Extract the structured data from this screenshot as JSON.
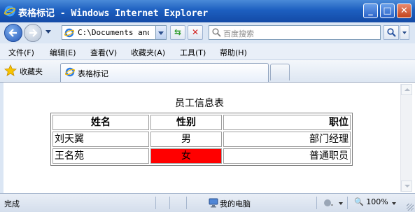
{
  "window": {
    "title": "表格标记 - Windows Internet Explorer",
    "min_icon": "minimize-icon",
    "max_icon": "maximize-icon",
    "close_icon": "close-icon",
    "frame_color": "#1d5fc0"
  },
  "address_bar": {
    "url": "C:\\Documents and S",
    "page_icon": "ie-page-icon"
  },
  "search": {
    "placeholder": "百度搜索"
  },
  "menu": [
    "文件(F)",
    "编辑(E)",
    "查看(V)",
    "收藏夹(A)",
    "工具(T)",
    "帮助(H)"
  ],
  "favorites": {
    "label": "收藏夹"
  },
  "tab": {
    "label": "表格标记"
  },
  "page": {
    "caption": "员工信息表",
    "headers": [
      "姓名",
      "性别",
      "职位"
    ],
    "rows": [
      [
        "刘天翼",
        "男",
        "部门经理"
      ],
      [
        "王名苑",
        "女",
        "普通职员"
      ]
    ],
    "highlight_color": "#ff0000"
  },
  "status": {
    "text": "完成",
    "zone": "我的电脑",
    "zoom": "100%"
  }
}
